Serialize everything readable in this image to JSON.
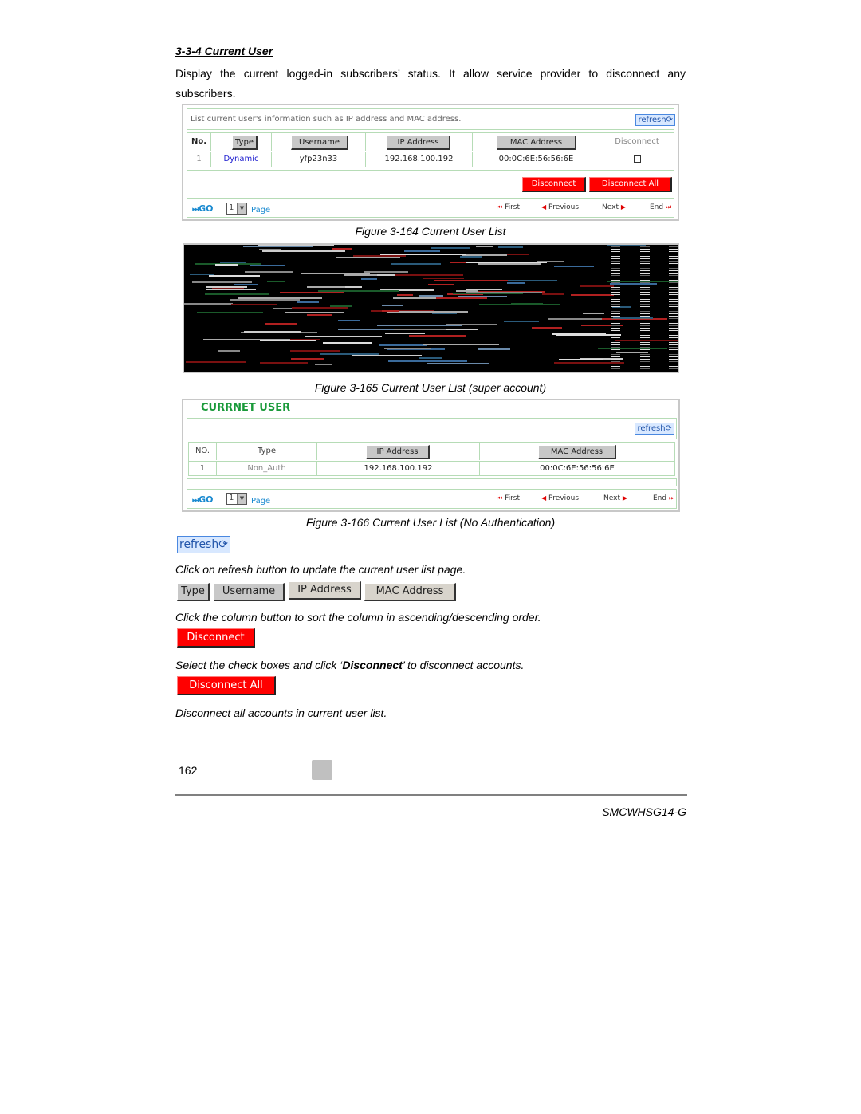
{
  "section": {
    "heading": "3-3-4 Current User",
    "intro": "Display the current logged-in subscribers’ status. It allow service provider to disconnect any subscribers."
  },
  "figure164": {
    "description": "List current user's information such as IP address and MAC address.",
    "refresh_label": "refresh",
    "columns": {
      "no": "No.",
      "type": "Type",
      "username": "Username",
      "ip": "IP Address",
      "mac": "MAC Address",
      "disconnect": "Disconnect"
    },
    "rows": [
      {
        "no": "1",
        "type": "Dynamic",
        "username": "yfp23n33",
        "ip": "192.168.100.192",
        "mac": "00:0C:6E:56:56:6E",
        "selected": false
      }
    ],
    "disconnect_label": "Disconnect",
    "disconnect_all_label": "Disconnect All",
    "go_label": "GO",
    "page_value": "1",
    "page_label": "Page",
    "nav": {
      "first": "First",
      "previous": "Previous",
      "next": "Next",
      "end": "End"
    },
    "caption": "Figure 3-164 Current User List"
  },
  "figure165": {
    "caption": "Figure 3-165 Current User List (super account)"
  },
  "figure166": {
    "title": "CURRNET USER",
    "refresh_label": "refresh",
    "columns": {
      "no": "NO.",
      "type": "Type",
      "ip": "IP Address",
      "mac": "MAC Address"
    },
    "rows": [
      {
        "no": "1",
        "type": "Non_Auth",
        "ip": "192.168.100.192",
        "mac": "00:0C:6E:56:56:6E"
      }
    ],
    "go_label": "GO",
    "page_value": "1",
    "page_label": "Page",
    "nav": {
      "first": "First",
      "previous": "Previous",
      "next": "Next",
      "end": "End"
    },
    "caption": "Figure 3-166 Current User List (No Authentication)"
  },
  "explanations": {
    "refresh_label": "refresh",
    "refresh_text": "Click on refresh button to update the current user list page.",
    "sort_buttons": [
      "Type",
      "Username",
      "IP Address",
      "MAC Address"
    ],
    "sort_text": "Click the column button to sort the column in ascending/descending order.",
    "disconnect_label": "Disconnect",
    "disconnect_text_pre": "Select the check boxes and click ‘",
    "disconnect_text_bold": "Disconnect",
    "disconnect_text_post": "’ to disconnect accounts.",
    "disconnect_all_label": "Disconnect All",
    "disconnect_all_text": "Disconnect all accounts in current user list."
  },
  "footer": {
    "page_number": "162",
    "model": "SMCWHSG14-G"
  },
  "colors": {
    "danger": "#ff0000",
    "link": "#1a8ad0",
    "title_green": "#1a9a3a",
    "table_border": "#b6dcb6"
  }
}
